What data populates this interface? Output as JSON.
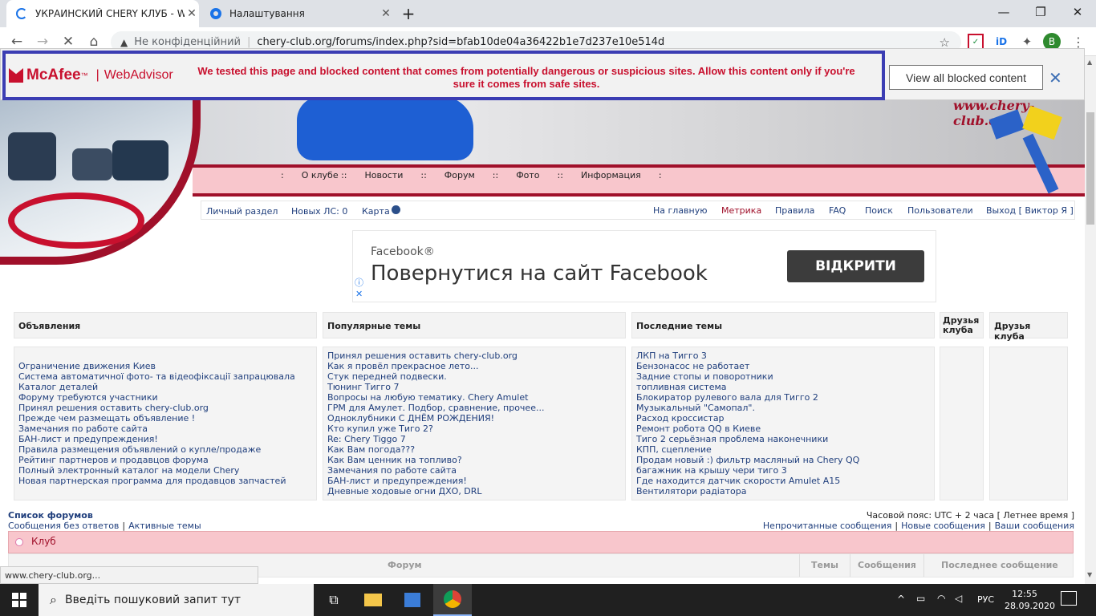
{
  "browser": {
    "tabs": [
      {
        "title": "УКРАИНСКИЙ CHERY КЛУБ - WWW",
        "active": true
      },
      {
        "title": "Налаштування",
        "active": false
      }
    ],
    "new_tab": "+",
    "window": {
      "minimize": "—",
      "maximize": "❐",
      "close": "✕"
    },
    "security_label": "Не конфіденційний",
    "url": "chery-club.org/forums/index.php?sid=bfab10de04a36422b1e7d237e10e514d",
    "profile_initial": "B"
  },
  "mcafee": {
    "brand": "McAfee",
    "tm": "™",
    "product": "WebAdvisor",
    "message": "We tested this page and blocked content that comes from potentially dangerous or suspicious sites. Allow this content only if you're sure it comes from safe sites.",
    "button": "View all blocked content",
    "close": "✕"
  },
  "site": {
    "watermark": "www.chery-club.org",
    "menu": [
      ":",
      "О клубе ::",
      "Новости",
      "::",
      "Форум",
      "::",
      "Фото",
      "::",
      "Информация",
      ":"
    ],
    "user_left": [
      "Личный раздел",
      "Новых ЛС: 0",
      "Карта"
    ],
    "user_right": [
      "На главную",
      "Метрика",
      "Правила",
      "FAQ",
      "Поиск",
      "Пользователи",
      "Выход [ Виктор Я ]"
    ]
  },
  "ad": {
    "brand": "Facebook®",
    "headline": "Повернутися на сайт Facebook",
    "button": "ВІДКРИТИ"
  },
  "columns": [
    {
      "title": "Объявления",
      "items": [
        "",
        "Ограничение движения Киев",
        "Система автоматичної фото- та відеофіксації запрацювала",
        "Каталог деталей",
        "Форуму требуются участники",
        "Принял решения оставить chery-club.org",
        "Прежде чем размещать объявление !",
        "Замечания по работе сайта",
        "БАН-лист и предупреждения!",
        "Правила размещения объявлений о купле/продаже",
        "Рейтинг партнеров и продавцов форума",
        "Полный электронный каталог на модели Chery",
        "Новая партнерская программа для продавцов запчастей"
      ]
    },
    {
      "title": "Популярные темы",
      "items": [
        "Принял решения оставить chery-club.org",
        "Как я провёл прекрасное лето...",
        "Стук передней подвески.",
        "Тюнинг Тигго 7",
        "Вопросы на любую тематику. Chery Amulet",
        "ГРМ для Амулет. Подбор, сравнение, прочее...",
        "Одноклубники С ДНЁМ РОЖДЕНИЯ!",
        "Кто купил уже Тиго 2?",
        "Re: Chery Tiggo 7",
        "Как Вам погода???",
        "Как Вам ценник на топливо?",
        "Замечания по работе сайта",
        "БАН-лист и предупреждения!",
        "Дневные ходовые огни ДХО, DRL"
      ]
    },
    {
      "title": "Последние темы",
      "items": [
        "ЛКП на Тигго 3",
        "Бензонасос не работает",
        "Задние стопы и поворотники",
        "топливная система",
        "Блокиратор рулевого вала для Тигго 2",
        "Музыкальный \"Самопал\".",
        "Расход кроссистар",
        "Ремонт робота QQ в Киеве",
        "Тиго 2 серьёзная проблема наконечники",
        "КПП, сцепление",
        "Продам новый :) фильтр масляный на Chery QQ",
        "багажник на крышу чери тиго 3",
        "Где находится датчик скорости Amulet A15",
        "Вентилятори радіатора"
      ]
    },
    {
      "title": "Друзья клуба",
      "items": []
    },
    {
      "title": "Друзья клуба",
      "items": []
    }
  ],
  "forum": {
    "list_link": "Список форумов",
    "unanswered": "Сообщения без ответов",
    "sep": "|",
    "active": "Активные темы",
    "timezone": "Часовой пояс: UTC + 2 часа [ Летнее время ]",
    "unread": "Непрочитанные сообщения",
    "new": "Новые сообщения",
    "yours": "Ваши сообщения",
    "category": "Клуб",
    "headers": [
      "Форум",
      "Темы",
      "Сообщения",
      "Последнее сообщение"
    ]
  },
  "status_url": "www.chery-club.org...",
  "taskbar": {
    "search_placeholder": "Введіть пошуковий запит тут",
    "lang": "РУС",
    "time": "12:55",
    "date": "28.09.2020"
  },
  "colors": {
    "accent": "#1a73e8",
    "mcafee_red": "#c8102e",
    "border_blue": "#3b3db3",
    "site_red": "#a0102a",
    "pink": "#f8c6cc"
  }
}
